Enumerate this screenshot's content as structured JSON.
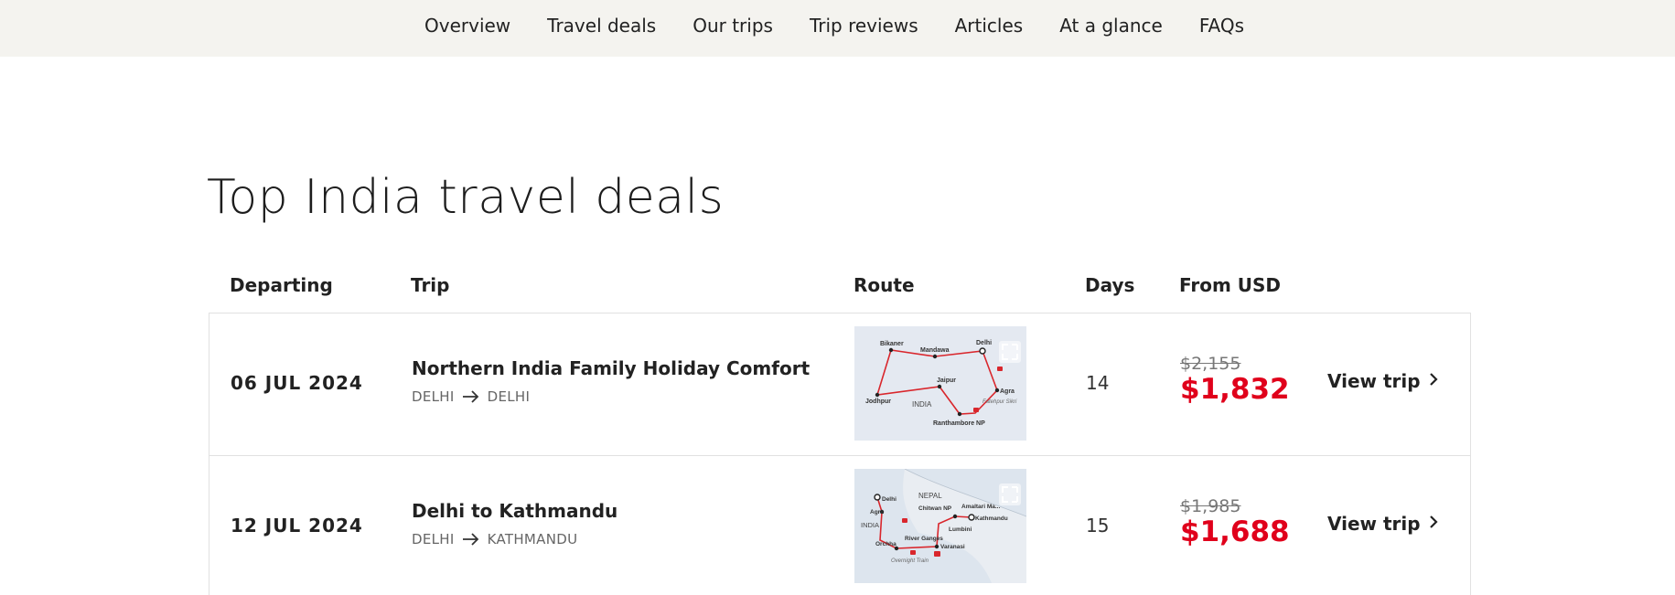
{
  "nav": {
    "items": [
      "Overview",
      "Travel deals",
      "Our trips",
      "Trip reviews",
      "Articles",
      "At a glance",
      "FAQs"
    ]
  },
  "page_title": "Top India travel deals",
  "table": {
    "headers": {
      "departing": "Departing",
      "trip": "Trip",
      "route": "Route",
      "days": "Days",
      "price": "From USD"
    },
    "rows": [
      {
        "departing": "06 JUL 2024",
        "trip_name": "Northern India Family Holiday Comfort",
        "from": "DELHI",
        "to": "DELHI",
        "map_labels": [
          "Bikaner",
          "Mandawa",
          "Delhi",
          "Jaipur",
          "Agra",
          "Fatehpur Sikri",
          "Jodhpur",
          "INDIA",
          "Ranthambore NP"
        ],
        "days": "14",
        "price_old": "$2,155",
        "price_new": "$1,832",
        "view_label": "View trip"
      },
      {
        "departing": "12 JUL 2024",
        "trip_name": "Delhi to Kathmandu",
        "from": "DELHI",
        "to": "KATHMANDU",
        "map_labels": [
          "Delhi",
          "NEPAL",
          "Agra",
          "Chitwan NP",
          "Amaltari Ma...",
          "Kathmandu",
          "INDIA",
          "Lumbini",
          "River Ganges",
          "Orchha",
          "Varanasi",
          "Overnight Train"
        ],
        "days": "15",
        "price_old": "$1,985",
        "price_new": "$1,688",
        "view_label": "View trip"
      }
    ]
  },
  "colors": {
    "nav_bg": "#f4f3ef",
    "price_red": "#e0001b",
    "route_red": "#d9262c"
  },
  "icons": {
    "arrow": "arrow-right-icon",
    "chevron": "chevron-right-icon",
    "expand": "expand-icon"
  }
}
